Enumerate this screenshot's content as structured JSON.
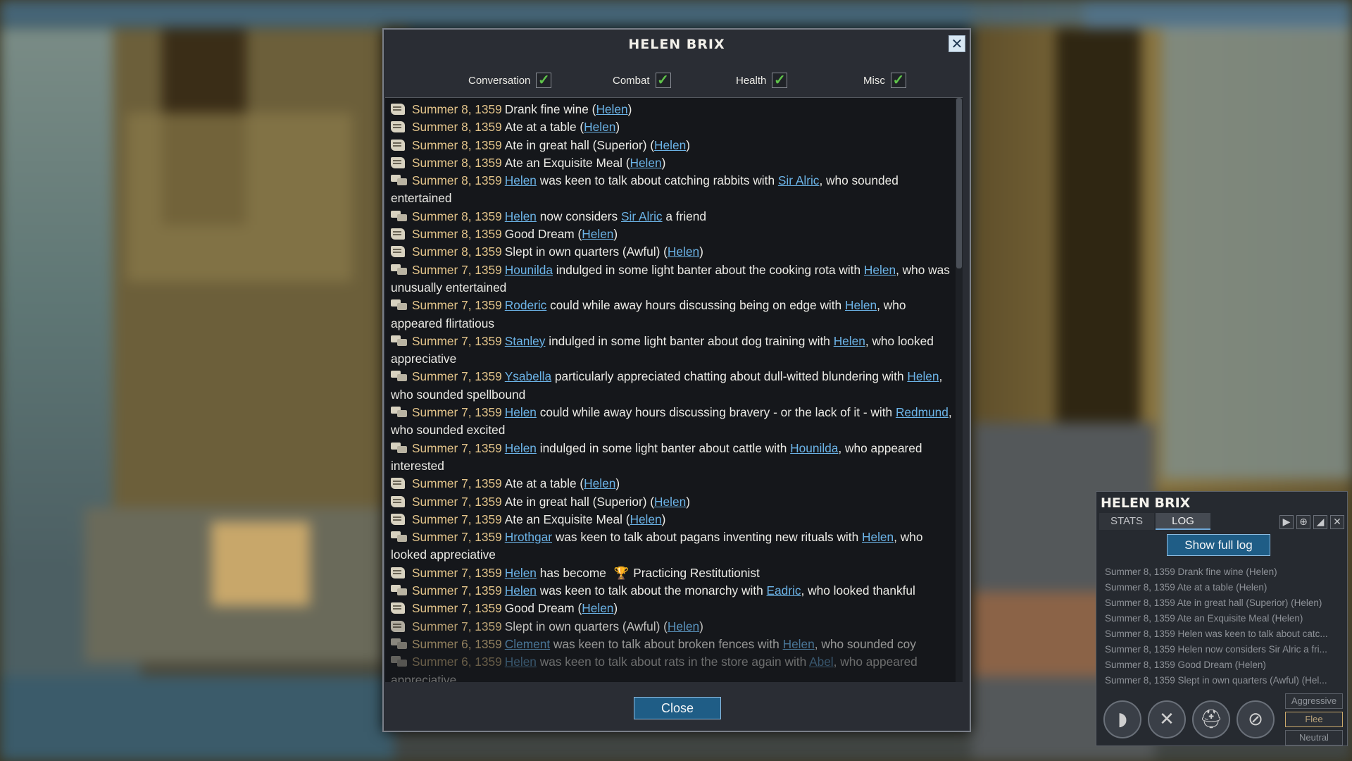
{
  "dialog": {
    "title": "HELEN BRIX",
    "close_icon": "✕",
    "filters": [
      {
        "label": "Conversation",
        "checked": true
      },
      {
        "label": "Combat",
        "checked": true
      },
      {
        "label": "Health",
        "checked": true
      },
      {
        "label": "Misc",
        "checked": true
      }
    ],
    "close_label": "Close"
  },
  "log_entries": [
    {
      "icon": "scroll-icon",
      "date": "Summer 8, 1359",
      "parts": [
        [
          "t",
          "Drank fine wine ("
        ],
        [
          "l",
          "Helen"
        ],
        [
          "t",
          ")"
        ]
      ]
    },
    {
      "icon": "scroll-icon",
      "date": "Summer 8, 1359",
      "parts": [
        [
          "t",
          "Ate at a table ("
        ],
        [
          "l",
          "Helen"
        ],
        [
          "t",
          ")"
        ]
      ]
    },
    {
      "icon": "scroll-icon",
      "date": "Summer 8, 1359",
      "parts": [
        [
          "t",
          "Ate in great hall (Superior) ("
        ],
        [
          "l",
          "Helen"
        ],
        [
          "t",
          ")"
        ]
      ]
    },
    {
      "icon": "scroll-icon",
      "date": "Summer 8, 1359",
      "parts": [
        [
          "t",
          "Ate an Exquisite Meal ("
        ],
        [
          "l",
          "Helen"
        ],
        [
          "t",
          ")"
        ]
      ]
    },
    {
      "icon": "chat-icon",
      "date": "Summer 8, 1359",
      "parts": [
        [
          "l",
          "Helen"
        ],
        [
          "t",
          " was keen to talk about catching rabbits with "
        ],
        [
          "l",
          "Sir Alric"
        ],
        [
          "t",
          ", who sounded entertained"
        ]
      ]
    },
    {
      "icon": "chat-icon",
      "date": "Summer 8, 1359",
      "parts": [
        [
          "l",
          "Helen"
        ],
        [
          "t",
          " now considers "
        ],
        [
          "l",
          "Sir Alric"
        ],
        [
          "t",
          " a friend"
        ]
      ]
    },
    {
      "icon": "scroll-icon",
      "date": "Summer 8, 1359",
      "parts": [
        [
          "t",
          "Good Dream ("
        ],
        [
          "l",
          "Helen"
        ],
        [
          "t",
          ")"
        ]
      ]
    },
    {
      "icon": "scroll-icon",
      "date": "Summer 8, 1359",
      "parts": [
        [
          "t",
          "Slept in own quarters (Awful) ("
        ],
        [
          "l",
          "Helen"
        ],
        [
          "t",
          ")"
        ]
      ]
    },
    {
      "icon": "chat-icon",
      "date": "Summer 7, 1359",
      "parts": [
        [
          "l",
          "Hounilda"
        ],
        [
          "t",
          " indulged in some light banter about the cooking rota with "
        ],
        [
          "l",
          "Helen"
        ],
        [
          "t",
          ", who was unusually entertained"
        ]
      ]
    },
    {
      "icon": "chat-icon",
      "date": "Summer 7, 1359",
      "parts": [
        [
          "l",
          "Roderic"
        ],
        [
          "t",
          " could while away hours discussing being on edge with "
        ],
        [
          "l",
          "Helen"
        ],
        [
          "t",
          ", who appeared flirtatious"
        ]
      ]
    },
    {
      "icon": "chat-icon",
      "date": "Summer 7, 1359",
      "parts": [
        [
          "l",
          "Stanley"
        ],
        [
          "t",
          " indulged in some light banter about dog training with "
        ],
        [
          "l",
          "Helen"
        ],
        [
          "t",
          ", who looked appreciative"
        ]
      ]
    },
    {
      "icon": "chat-icon",
      "date": "Summer 7, 1359",
      "parts": [
        [
          "l",
          "Ysabella"
        ],
        [
          "t",
          " particularly appreciated chatting about dull-witted blundering with "
        ],
        [
          "l",
          "Helen"
        ],
        [
          "t",
          ", who sounded spellbound"
        ]
      ]
    },
    {
      "icon": "chat-icon",
      "date": "Summer 7, 1359",
      "parts": [
        [
          "l",
          "Helen"
        ],
        [
          "t",
          " could while away hours discussing bravery - or the lack of it -  with "
        ],
        [
          "l",
          "Redmund"
        ],
        [
          "t",
          ", who sounded excited"
        ]
      ]
    },
    {
      "icon": "chat-icon",
      "date": "Summer 7, 1359",
      "parts": [
        [
          "l",
          "Helen"
        ],
        [
          "t",
          " indulged in some light banter about cattle with "
        ],
        [
          "l",
          "Hounilda"
        ],
        [
          "t",
          ", who appeared interested"
        ]
      ]
    },
    {
      "icon": "scroll-icon",
      "date": "Summer 7, 1359",
      "parts": [
        [
          "t",
          "Ate at a table ("
        ],
        [
          "l",
          "Helen"
        ],
        [
          "t",
          ")"
        ]
      ]
    },
    {
      "icon": "scroll-icon",
      "date": "Summer 7, 1359",
      "parts": [
        [
          "t",
          "Ate in great hall (Superior) ("
        ],
        [
          "l",
          "Helen"
        ],
        [
          "t",
          ")"
        ]
      ]
    },
    {
      "icon": "scroll-icon",
      "date": "Summer 7, 1359",
      "parts": [
        [
          "t",
          "Ate an Exquisite Meal ("
        ],
        [
          "l",
          "Helen"
        ],
        [
          "t",
          ")"
        ]
      ]
    },
    {
      "icon": "chat-icon",
      "date": "Summer 7, 1359",
      "parts": [
        [
          "l",
          "Hrothgar"
        ],
        [
          "t",
          " was keen to talk about pagans inventing new rituals with "
        ],
        [
          "l",
          "Helen"
        ],
        [
          "t",
          ", who looked appreciative"
        ]
      ]
    },
    {
      "icon": "scroll-icon",
      "date": "Summer 7, 1359",
      "parts": [
        [
          "l",
          "Helen"
        ],
        [
          "t",
          " has become "
        ],
        [
          "e",
          "🏆"
        ],
        [
          "t",
          "Practicing Restitutionist"
        ]
      ]
    },
    {
      "icon": "chat-icon",
      "date": "Summer 7, 1359",
      "parts": [
        [
          "l",
          "Helen"
        ],
        [
          "t",
          " was keen to talk about the monarchy with "
        ],
        [
          "l",
          "Eadric"
        ],
        [
          "t",
          ", who looked thankful"
        ]
      ]
    },
    {
      "icon": "scroll-icon",
      "date": "Summer 7, 1359",
      "parts": [
        [
          "t",
          "Good Dream ("
        ],
        [
          "l",
          "Helen"
        ],
        [
          "t",
          ")"
        ]
      ]
    },
    {
      "icon": "scroll-icon",
      "date": "Summer 7, 1359",
      "parts": [
        [
          "t",
          "Slept in own quarters (Awful) ("
        ],
        [
          "l",
          "Helen"
        ],
        [
          "t",
          ")"
        ]
      ]
    },
    {
      "icon": "chat-icon",
      "date": "Summer 6, 1359",
      "parts": [
        [
          "l",
          "Clement"
        ],
        [
          "t",
          " was keen to talk about broken fences with "
        ],
        [
          "l",
          "Helen"
        ],
        [
          "t",
          ", who sounded coy"
        ]
      ]
    },
    {
      "icon": "chat-icon",
      "date": "Summer 6, 1359",
      "parts": [
        [
          "l",
          "Helen"
        ],
        [
          "t",
          " was keen to talk about rats in the store again with "
        ],
        [
          "l",
          "Abel"
        ],
        [
          "t",
          ", who appeared appreciative"
        ]
      ]
    }
  ],
  "side_panel": {
    "title": "HELEN BRIX",
    "tabs": [
      "STATS",
      "LOG"
    ],
    "active_tab": "LOG",
    "header_icons": [
      "next-icon",
      "target-icon",
      "chart-icon",
      "close-icon"
    ],
    "show_full_log_label": "Show full log",
    "entries": [
      "Summer 8, 1359 Drank fine wine (Helen)",
      "Summer 8, 1359 Ate at a table (Helen)",
      "Summer 8, 1359 Ate in great hall (Superior) (Helen)",
      "Summer 8, 1359 Ate an Exquisite Meal (Helen)",
      "Summer 8, 1359 Helen was keen to talk about catc...",
      "Summer 8, 1359 Helen now considers Sir Alric a fri...",
      "Summer 8, 1359 Good Dream (Helen)",
      "Summer 8, 1359 Slept in own quarters (Awful) (Hel..."
    ],
    "stances": [
      "Aggressive",
      "Flee",
      "Neutral"
    ],
    "active_stance": "Flee",
    "actions": [
      "horn-icon",
      "swords-icon",
      "helmet-icon",
      "forbid-icon"
    ]
  }
}
